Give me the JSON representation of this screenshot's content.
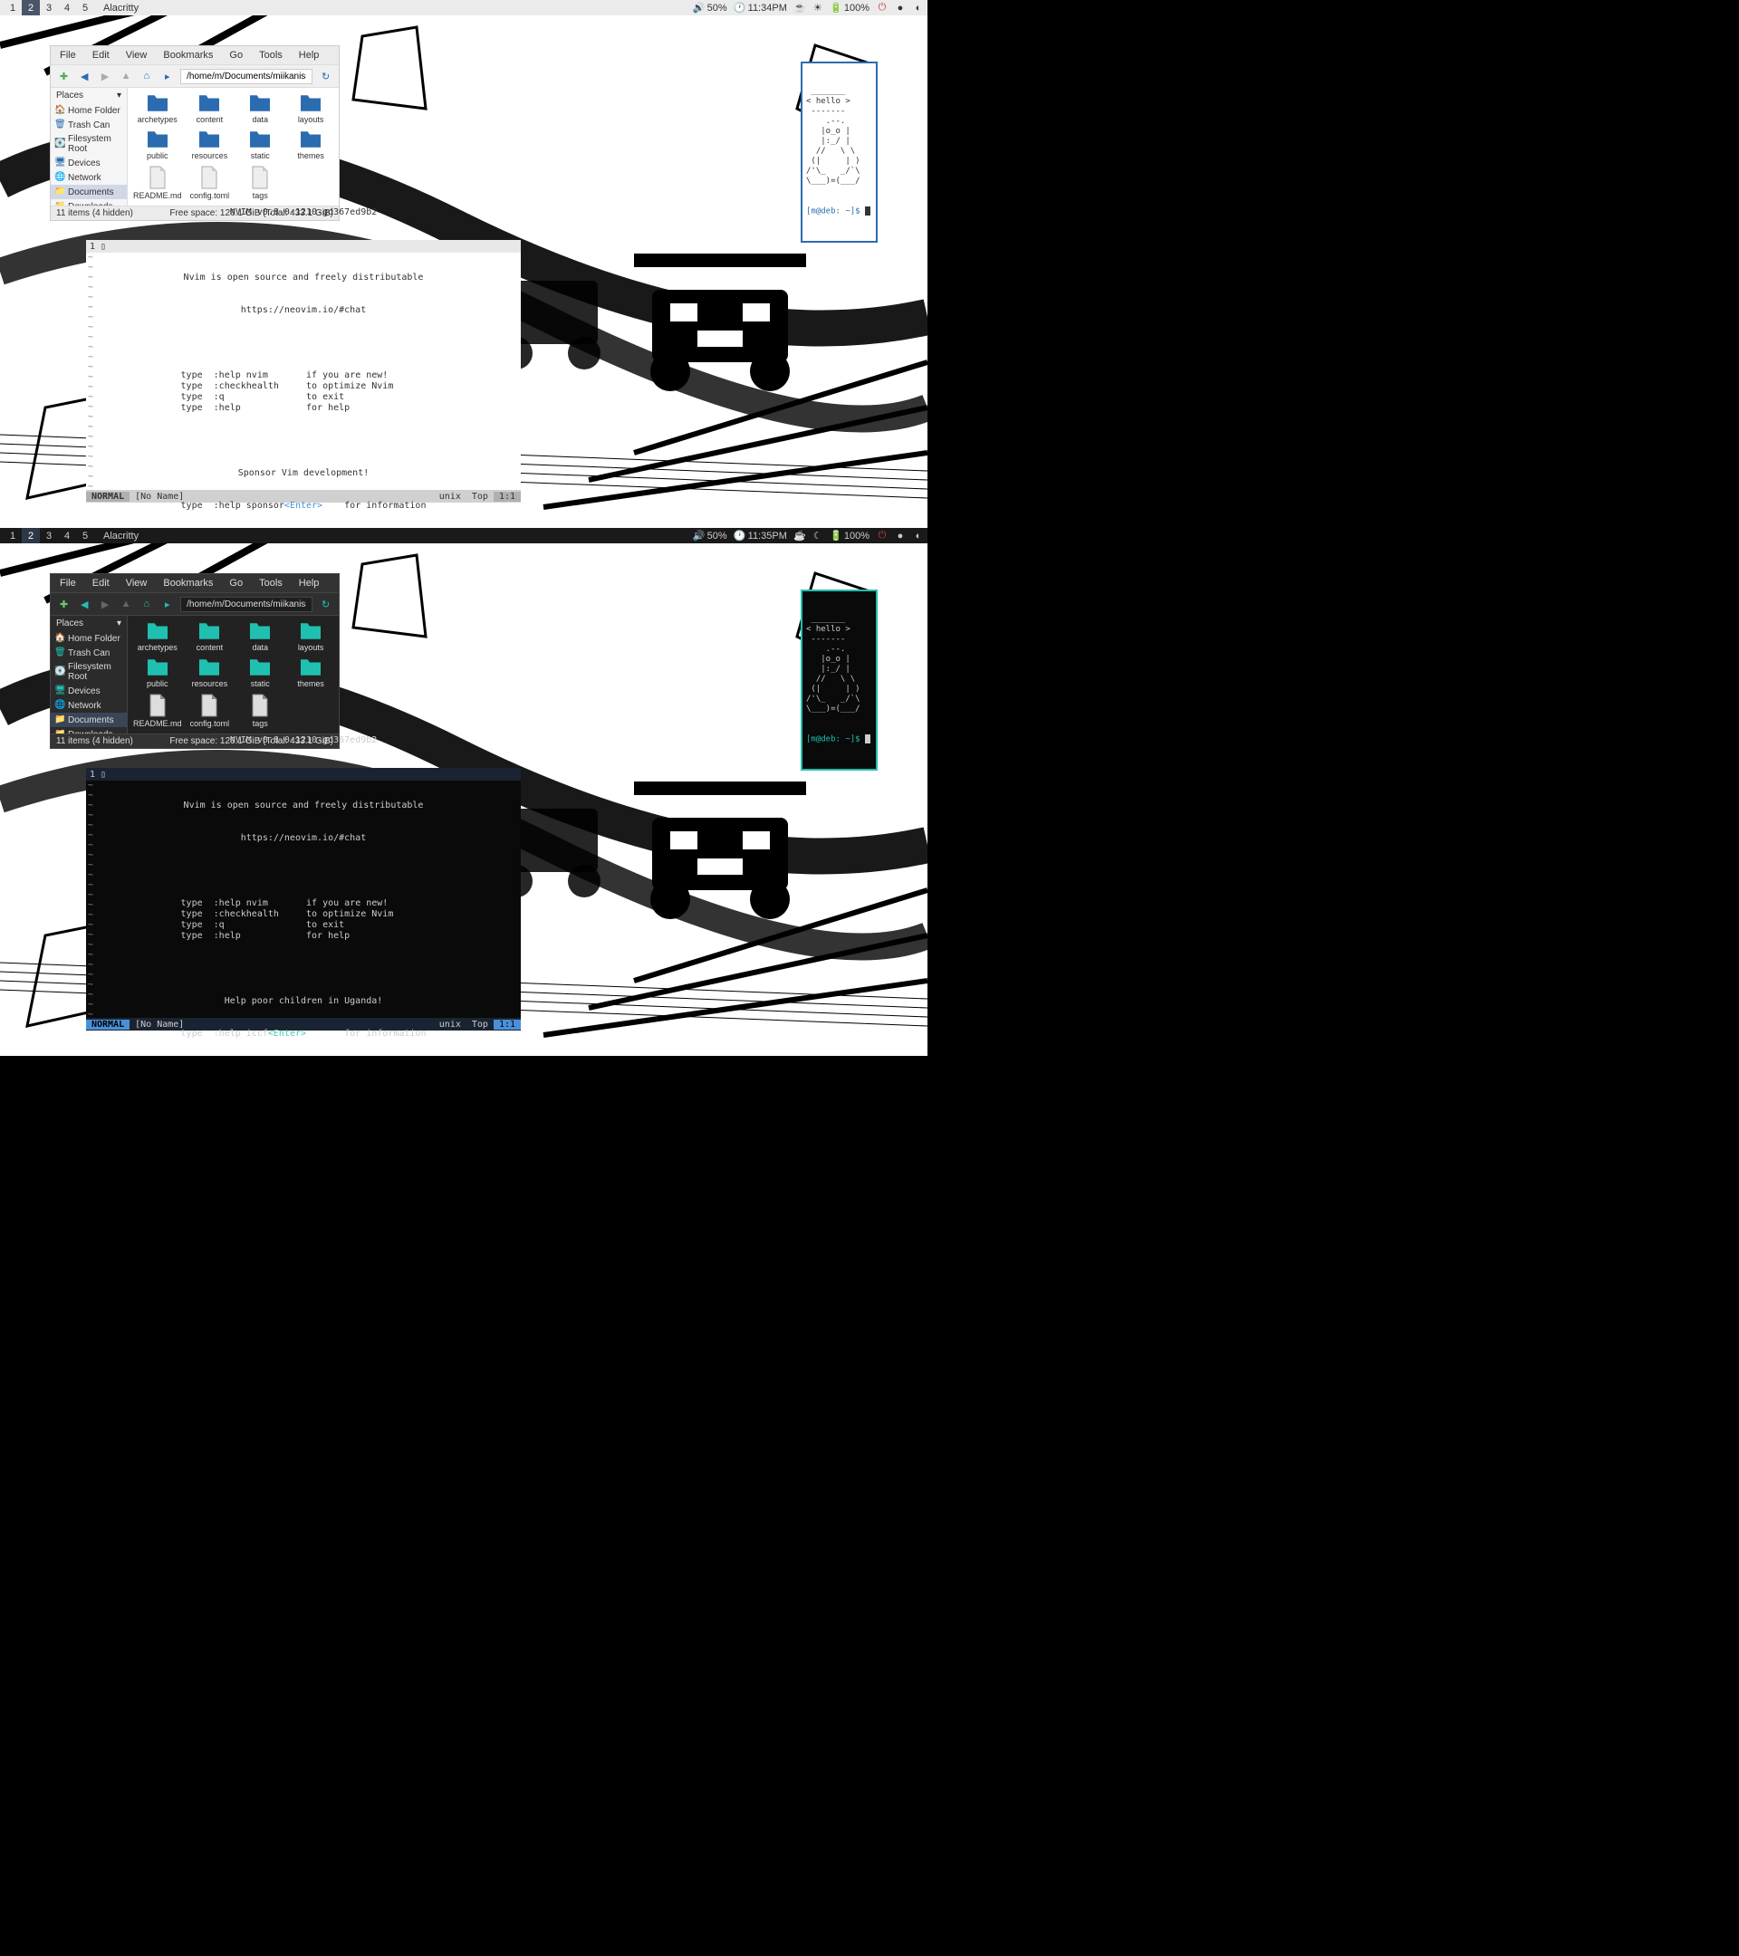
{
  "workspaces": [
    "1",
    "2",
    "3",
    "4",
    "5"
  ],
  "active_ws": "2",
  "app_title": "Alacritty",
  "tray": {
    "volume": "50%",
    "time_light": "11:34PM",
    "time_dark": "11:35PM",
    "battery": "100%"
  },
  "fm": {
    "menu": [
      "File",
      "Edit",
      "View",
      "Bookmarks",
      "Go",
      "Tools",
      "Help"
    ],
    "path": "/home/m/Documents/miikanissi.com",
    "places_label": "Places",
    "sidebar": [
      {
        "icon": "home",
        "label": "Home Folder"
      },
      {
        "icon": "trash",
        "label": "Trash Can"
      },
      {
        "icon": "disk",
        "label": "Filesystem Root"
      },
      {
        "icon": "devices",
        "label": "Devices"
      },
      {
        "icon": "network",
        "label": "Network"
      },
      {
        "icon": "folder",
        "label": "Documents",
        "sel": true
      },
      {
        "icon": "folder",
        "label": "Downloads"
      }
    ],
    "items": [
      {
        "type": "folder",
        "label": "archetypes"
      },
      {
        "type": "folder",
        "label": "content"
      },
      {
        "type": "folder",
        "label": "data"
      },
      {
        "type": "folder",
        "label": "layouts"
      },
      {
        "type": "folder",
        "label": "public"
      },
      {
        "type": "folder",
        "label": "resources"
      },
      {
        "type": "folder",
        "label": "static"
      },
      {
        "type": "folder",
        "label": "themes"
      },
      {
        "type": "file",
        "label": "README.md"
      },
      {
        "type": "file",
        "label": "config.toml"
      },
      {
        "type": "file",
        "label": "tags"
      }
    ],
    "status_left": "11 items (4 hidden)",
    "status_right": "Free space: 126.1 GiB (Total: 433.1 GiB)"
  },
  "nvim": {
    "line_no": "1",
    "cursor": "▯",
    "version": "NVIM v0.8.0-1210-gd367ed9b2",
    "tagline1": "Nvim is open source and freely distributable",
    "tagline2": "https://neovim.io/#chat",
    "help_lines": [
      {
        "pre": "type  :help nvim",
        "enter": "<Enter>",
        "post": "       if you are new!"
      },
      {
        "pre": "type  :checkhealth",
        "enter": "<Enter>",
        "post": "     to optimize Nvim"
      },
      {
        "pre": "type  :q",
        "enter": "<Enter>",
        "post": "               to exit"
      },
      {
        "pre": "type  :help",
        "enter": "<Enter>",
        "post": "            for help"
      }
    ],
    "sponsor_light": "Sponsor Vim development!",
    "sponsor_dark": "Help poor children in Uganda!",
    "sponsor_line_light": {
      "pre": "type  :help sponsor",
      "enter": "<Enter>",
      "post": "    for information"
    },
    "sponsor_line_dark": {
      "pre": "type  :help iccf",
      "enter": "<Enter>",
      "post": "       for information"
    },
    "mode": "NORMAL",
    "name": "[No Name]",
    "right1": "unix",
    "right2": "Top",
    "right3": "1:1"
  },
  "term": {
    "art": " _______\n< hello >\n -------\n    .--.\n   |o_o |\n   |:_/ |\n  //   \\ \\\n (|     | )\n/'\\_   _/`\\\n\\___)=(___/",
    "prompt": "[m@deb: ~]$ "
  }
}
